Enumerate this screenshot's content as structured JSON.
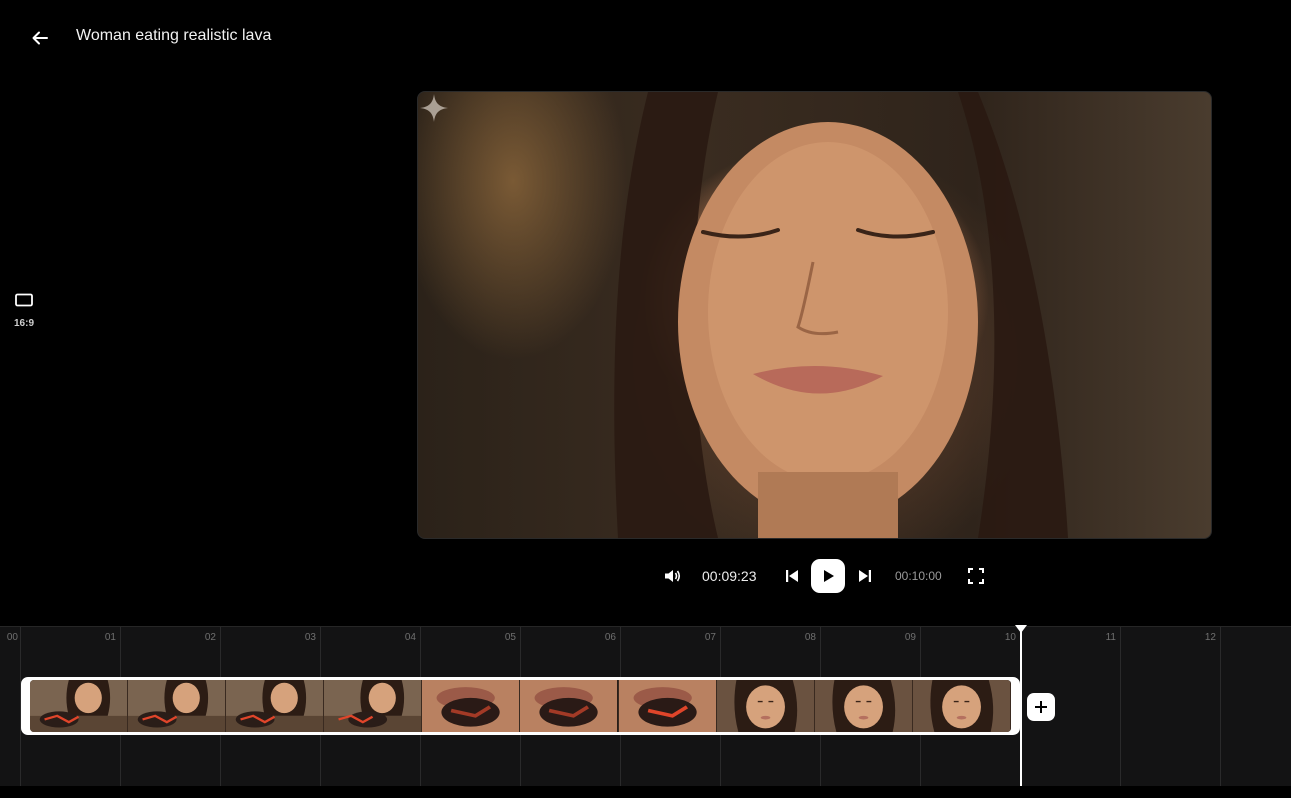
{
  "header": {
    "back_icon": "arrow-left-icon",
    "title": "Woman eating realistic lava"
  },
  "aspect": {
    "icon": "rectangle-landscape-icon",
    "label": "16:9"
  },
  "player": {
    "current_time": "00:09:23",
    "total_time": "00:10:00",
    "icons": [
      "volume-icon",
      "skip-previous-icon",
      "play-icon",
      "skip-next-icon",
      "fullscreen-icon"
    ]
  },
  "timeline": {
    "ticks": [
      "00",
      "01",
      "02",
      "03",
      "04",
      "05",
      "06",
      "07",
      "08",
      "09",
      "10",
      "11",
      "12"
    ],
    "clip_frames": [
      {
        "scene": "woman-with-lava-rock"
      },
      {
        "scene": "woman-with-lava-rock"
      },
      {
        "scene": "woman-with-lava-rock"
      },
      {
        "scene": "woman-holding-lava-rock"
      },
      {
        "scene": "mouth-biting-lava"
      },
      {
        "scene": "mouth-biting-lava"
      },
      {
        "scene": "mouth-biting-lava-glowing"
      },
      {
        "scene": "woman-face"
      },
      {
        "scene": "woman-face"
      },
      {
        "scene": "woman-face"
      }
    ],
    "add_icon": "plus-icon"
  },
  "colors": {
    "background": "#000000",
    "timeline_bg": "#131314",
    "accent": "#ffffff",
    "lava": "#e0452a"
  }
}
